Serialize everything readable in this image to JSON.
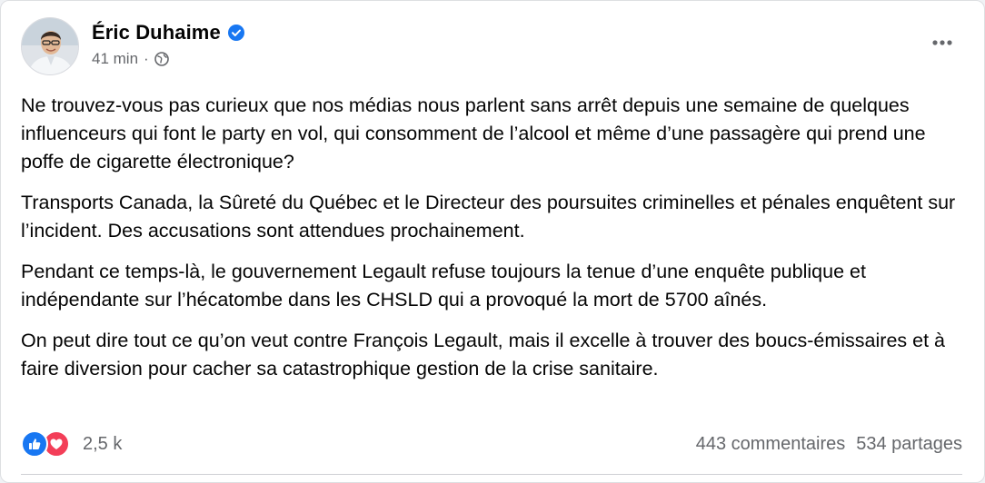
{
  "post": {
    "author": "Éric Duhaime",
    "timestamp": "41 min",
    "separator": "·",
    "audience_icon": "globe-icon",
    "verified_icon": "verified-badge-icon",
    "more_icon": "more-options-icon",
    "paragraphs": [
      "Ne trouvez-vous pas curieux que nos médias nous parlent sans arrêt depuis une semaine de quelques influenceurs qui font le party en vol, qui consomment de l’alcool et même d’une passagère qui prend une poffe de cigarette électronique?",
      "Transports Canada, la Sûreté du Québec et le Directeur des poursuites criminelles et pénales enquêtent sur l’incident. Des accusations sont attendues prochainement.",
      "Pendant ce temps-là, le gouvernement Legault refuse toujours la tenue d’une enquête publique et indépendante sur l’hécatombe dans les CHSLD qui a provoqué la mort de 5700 aînés.",
      "On peut dire tout ce qu’on veut contre François Legault, mais il excelle à trouver des boucs-émissaires et à faire diversion pour cacher sa catastrophique gestion de la crise sanitaire."
    ]
  },
  "footer": {
    "reaction_icons": [
      "like-reaction-icon",
      "love-reaction-icon"
    ],
    "reaction_count": "2,5 k",
    "comments": "443 commentaires",
    "shares": "534 partages"
  },
  "colors": {
    "like": "#1877f2",
    "love": "#f33e58",
    "verified": "#1877f2",
    "secondary_text": "#65676b"
  }
}
